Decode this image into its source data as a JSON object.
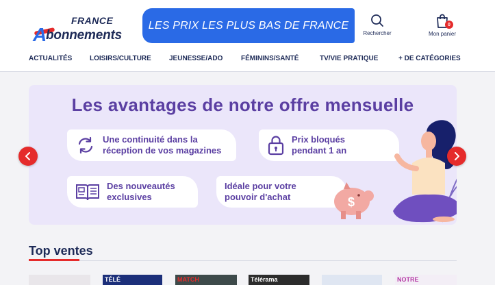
{
  "brand": {
    "line1": "FRANCE",
    "line2_a": "A",
    "line2_rest": "bonnements"
  },
  "banner": "LES PRIX LES PLUS BAS DE FRANCE",
  "header": {
    "search_label": "Rechercher",
    "cart_label": "Mon panier",
    "cart_count": "0"
  },
  "nav": [
    "ACTUALITÉS",
    "LOISIRS/CULTURE",
    "JEUNESSE/ADO",
    "FÉMININS/SANTÉ",
    "TV/VIE PRATIQUE",
    "+ DE CATÉGORIES"
  ],
  "carousel": {
    "title": "Les avantages de notre offre mensuelle",
    "features": [
      {
        "icon": "refresh-icon",
        "line1": "Une continuité dans la",
        "line2": "réception de vos magazines"
      },
      {
        "icon": "lock-icon",
        "line1": "Prix bloqués",
        "line2": "pendant 1 an"
      },
      {
        "icon": "book-icon",
        "line1": "Des nouveautés",
        "line2": "exclusives"
      },
      {
        "icon": "piggy-bank-icon",
        "line1": "Idéale pour votre",
        "line2": "pouvoir d'achat"
      }
    ]
  },
  "section": {
    "title": "Top ventes"
  },
  "magazines": [
    "",
    "TÉLÉ",
    "MATCH",
    "Télérama",
    "",
    "NOTRE"
  ],
  "colors": {
    "navy": "#1d2a57",
    "blue": "#2a6ae6",
    "red": "#e52b2b",
    "purple": "#5b3fa2",
    "lavender": "#ebe6fa"
  }
}
